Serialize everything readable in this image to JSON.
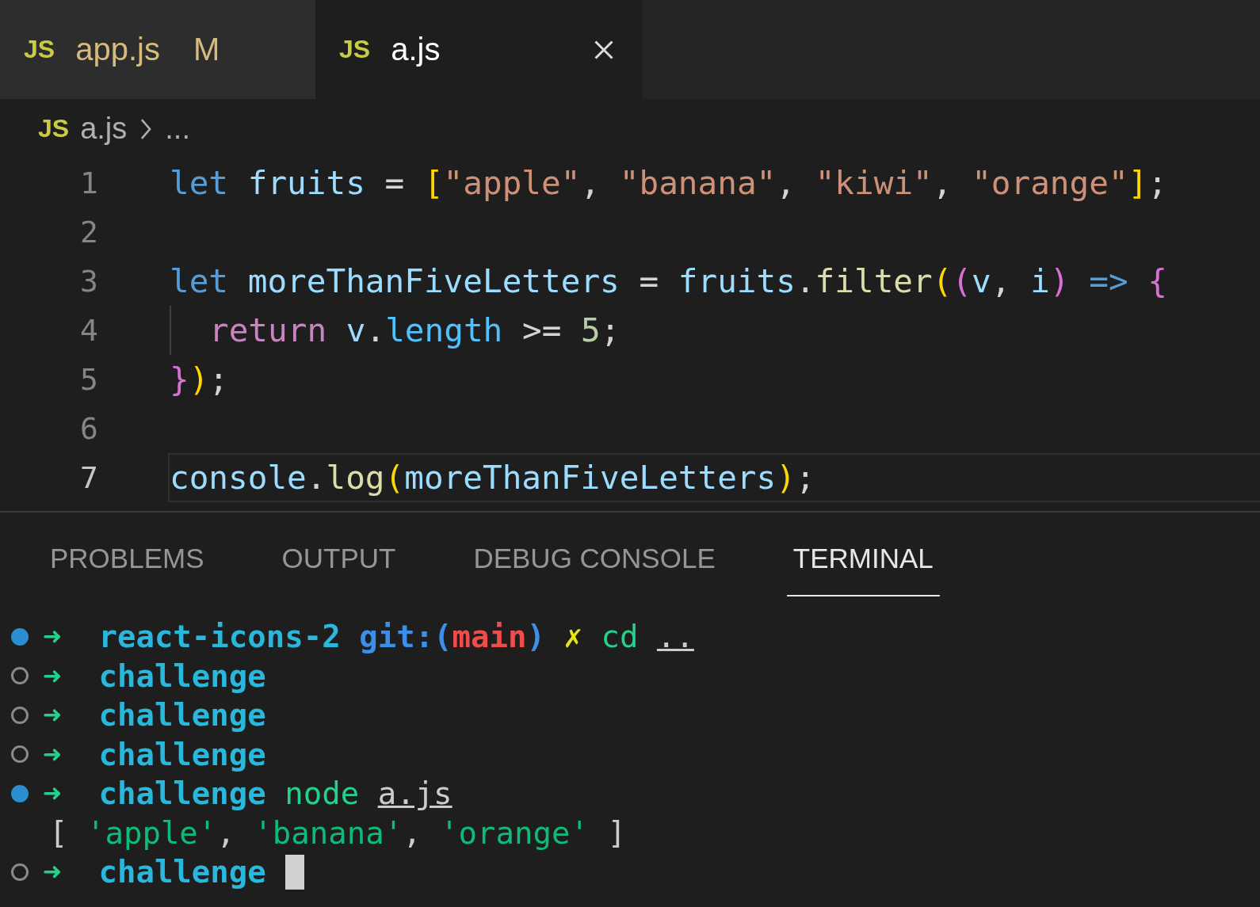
{
  "tabs": [
    {
      "icon_label": "JS",
      "label": "app.js",
      "badge": "M",
      "selected": false
    },
    {
      "icon_label": "JS",
      "label": "a.js",
      "selected": true
    }
  ],
  "breadcrumb": {
    "icon_label": "JS",
    "file": "a.js",
    "rest": "..."
  },
  "code_lines": [
    {
      "number": "1",
      "current": false,
      "indent_guide": false,
      "tokens": [
        {
          "kind": "keyword",
          "text": "let"
        },
        {
          "kind": "variable",
          "text": " fruits"
        },
        {
          "kind": "plain",
          "text": " = "
        },
        {
          "kind": "bracket1",
          "text": "["
        },
        {
          "kind": "string",
          "text": "\"apple\""
        },
        {
          "kind": "plain",
          "text": ", "
        },
        {
          "kind": "string",
          "text": "\"banana\""
        },
        {
          "kind": "plain",
          "text": ", "
        },
        {
          "kind": "string",
          "text": "\"kiwi\""
        },
        {
          "kind": "plain",
          "text": ", "
        },
        {
          "kind": "string",
          "text": "\"orange\""
        },
        {
          "kind": "bracket1",
          "text": "]"
        },
        {
          "kind": "plain",
          "text": ";"
        }
      ]
    },
    {
      "number": "2",
      "current": false,
      "indent_guide": false
    },
    {
      "number": "3",
      "current": false,
      "indent_guide": false,
      "tokens": [
        {
          "kind": "keyword",
          "text": "let"
        },
        {
          "kind": "variable",
          "text": " moreThanFiveLetters"
        },
        {
          "kind": "plain",
          "text": " = "
        },
        {
          "kind": "variable",
          "text": "fruits"
        },
        {
          "kind": "plain",
          "text": "."
        },
        {
          "kind": "function",
          "text": "filter"
        },
        {
          "kind": "bracket1",
          "text": "("
        },
        {
          "kind": "bracket2",
          "text": "("
        },
        {
          "kind": "variable",
          "text": "v"
        },
        {
          "kind": "plain",
          "text": ", "
        },
        {
          "kind": "variable",
          "text": "i"
        },
        {
          "kind": "bracket2",
          "text": ")"
        },
        {
          "kind": "keyword",
          "text": " =>"
        },
        {
          "kind": "bracket2",
          "text": " {"
        }
      ]
    },
    {
      "number": "4",
      "current": false,
      "indent_guide": true,
      "tokens": [
        {
          "kind": "control",
          "text": "return"
        },
        {
          "kind": "variable",
          "text": " v"
        },
        {
          "kind": "plain",
          "text": "."
        },
        {
          "kind": "property",
          "text": "length"
        },
        {
          "kind": "plain",
          "text": " >= "
        },
        {
          "kind": "number",
          "text": "5"
        },
        {
          "kind": "plain",
          "text": ";"
        }
      ]
    },
    {
      "number": "5",
      "current": false,
      "indent_guide": false,
      "tokens": [
        {
          "kind": "bracket2",
          "text": "}"
        },
        {
          "kind": "bracket1",
          "text": ")"
        },
        {
          "kind": "plain",
          "text": ";"
        }
      ]
    },
    {
      "number": "6",
      "current": false,
      "indent_guide": false
    },
    {
      "number": "7",
      "current": true,
      "indent_guide": false,
      "tokens": [
        {
          "kind": "variable",
          "text": "console"
        },
        {
          "kind": "plain",
          "text": "."
        },
        {
          "kind": "function",
          "text": "log"
        },
        {
          "kind": "bracket1",
          "text": "("
        },
        {
          "kind": "variable",
          "text": "moreThanFiveLetters"
        },
        {
          "kind": "bracket1",
          "text": ")"
        },
        {
          "kind": "plain",
          "text": ";"
        }
      ]
    }
  ],
  "panel_tabs": [
    {
      "label": "PROBLEMS",
      "selected": false
    },
    {
      "label": "OUTPUT",
      "selected": false
    },
    {
      "label": "DEBUG CONSOLE",
      "selected": false
    },
    {
      "label": "TERMINAL",
      "selected": true
    }
  ],
  "terminal": {
    "lines": [
      {
        "kind": "prompt",
        "marker_filled": true,
        "cursor": false,
        "parts": [
          {
            "kind": "arrow",
            "text": "➜  "
          },
          {
            "kind": "dir",
            "text": "react-icons-2 "
          },
          {
            "kind": "git",
            "text": "git:("
          },
          {
            "kind": "branch",
            "text": "main"
          },
          {
            "kind": "git",
            "text": ") "
          },
          {
            "kind": "dirty",
            "text": "✗ "
          },
          {
            "kind": "cmd",
            "text": "cd "
          },
          {
            "kind": "arg",
            "text": ".."
          }
        ]
      },
      {
        "kind": "prompt",
        "marker_filled": false,
        "cursor": false,
        "parts": [
          {
            "kind": "arrow",
            "text": "➜  "
          },
          {
            "kind": "dir",
            "text": "challenge"
          }
        ]
      },
      {
        "kind": "prompt",
        "marker_filled": false,
        "cursor": false,
        "parts": [
          {
            "kind": "arrow",
            "text": "➜  "
          },
          {
            "kind": "dir",
            "text": "challenge"
          }
        ]
      },
      {
        "kind": "prompt",
        "marker_filled": false,
        "cursor": false,
        "parts": [
          {
            "kind": "arrow",
            "text": "➜  "
          },
          {
            "kind": "dir",
            "text": "challenge"
          }
        ]
      },
      {
        "kind": "prompt",
        "marker_filled": true,
        "cursor": false,
        "parts": [
          {
            "kind": "arrow",
            "text": "➜  "
          },
          {
            "kind": "dir",
            "text": "challenge"
          },
          {
            "kind": "cmd",
            "text": " node "
          },
          {
            "kind": "arg",
            "text": "a.js"
          }
        ]
      },
      {
        "kind": "output",
        "cursor": false,
        "parts": [
          {
            "kind": "plain",
            "text": "[ "
          },
          {
            "kind": "str",
            "text": "'apple'"
          },
          {
            "kind": "plain",
            "text": ", "
          },
          {
            "kind": "str",
            "text": "'banana'"
          },
          {
            "kind": "plain",
            "text": ", "
          },
          {
            "kind": "str",
            "text": "'orange'"
          },
          {
            "kind": "plain",
            "text": " ]"
          }
        ]
      },
      {
        "kind": "prompt",
        "marker_filled": false,
        "cursor": true,
        "parts": [
          {
            "kind": "arrow",
            "text": "➜  "
          },
          {
            "kind": "dir",
            "text": "challenge"
          }
        ]
      }
    ]
  }
}
